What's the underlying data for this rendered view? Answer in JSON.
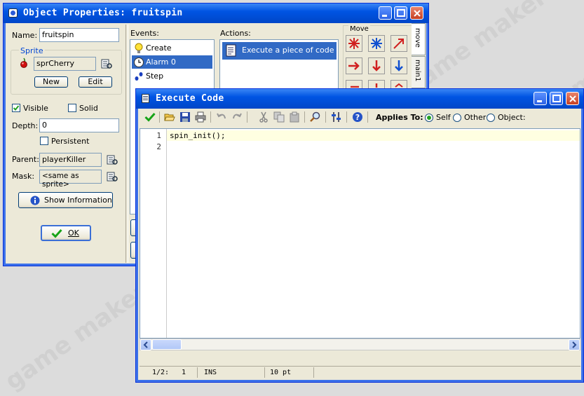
{
  "watermark": "game maker",
  "object_window": {
    "title": "Object Properties: fruitspin",
    "name_label": "Name:",
    "name_value": "fruitspin",
    "sprite_group_label": "Sprite",
    "sprite_value": "sprCherry",
    "new_label": "New",
    "edit_label": "Edit",
    "visible_label": "Visible",
    "solid_label": "Solid",
    "depth_label": "Depth:",
    "depth_value": "0",
    "persistent_label": "Persistent",
    "parent_label": "Parent:",
    "parent_value": "playerKiller",
    "mask_label": "Mask:",
    "mask_value": "<same as sprite>",
    "show_info_label": "Show Information",
    "ok_label": "OK",
    "visible_checked": true,
    "solid_checked": false,
    "persistent_checked": false,
    "events_label": "Events:",
    "events": [
      {
        "label": "Create",
        "icon": "lightbulb-icon",
        "selected": false
      },
      {
        "label": "Alarm 0",
        "icon": "clock-icon",
        "selected": true
      },
      {
        "label": "Step",
        "icon": "footsteps-icon",
        "selected": false
      }
    ],
    "actions_label": "Actions:",
    "actions": [
      {
        "label": "Execute a piece of code",
        "icon": "code-page-icon",
        "selected": true
      }
    ],
    "move_group_label": "Move",
    "side_tabs": [
      "move",
      "main1"
    ]
  },
  "code_window": {
    "title": "Execute Code",
    "applies_to_label": "Applies To:",
    "applies_options": [
      "Self",
      "Other",
      "Object:"
    ],
    "applies_selected": "Self",
    "lines": [
      {
        "num": "1",
        "text": "spin_init();"
      },
      {
        "num": "2",
        "text": ""
      }
    ],
    "status": {
      "position": "1/2:",
      "column": "1",
      "mode": "INS",
      "font_size": "10 pt"
    }
  },
  "colors": {
    "title_blue": "#0054e3",
    "selection": "#316ac5",
    "editor_highlight": "#ffffe1"
  }
}
